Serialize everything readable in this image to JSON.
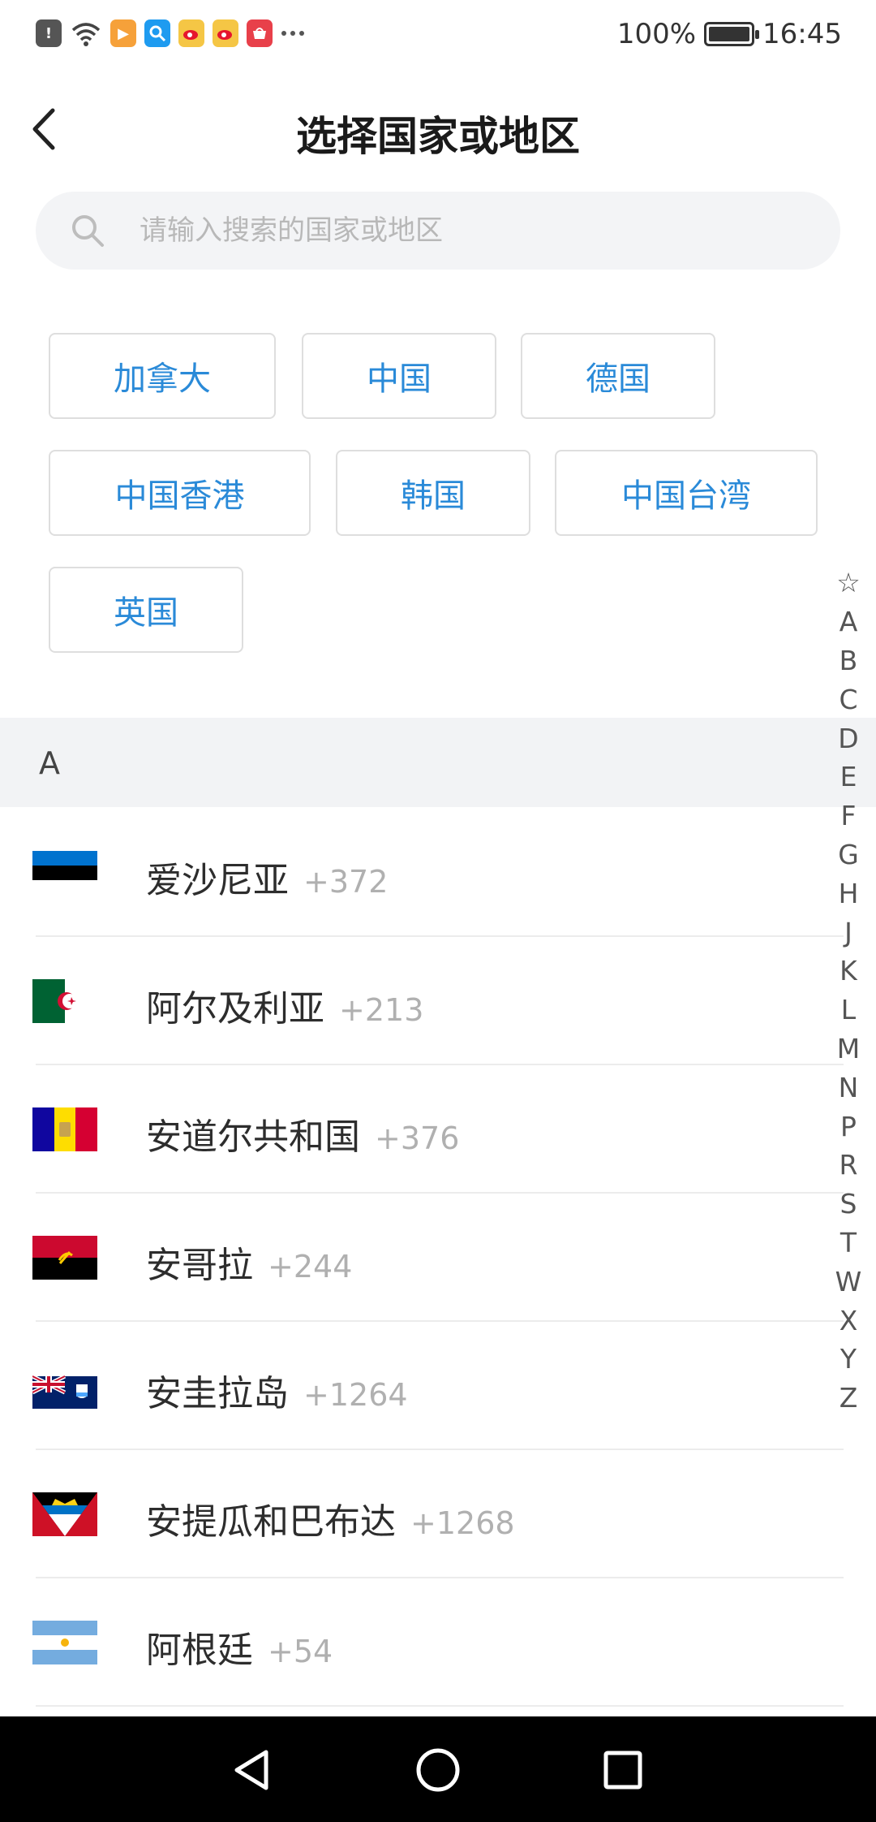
{
  "status_bar": {
    "battery_text": "100%",
    "time": "16:45",
    "battery_level": 1.0,
    "notification_icons": [
      "alert-icon",
      "wifi-icon",
      "video-app-icon",
      "search-app-icon",
      "weibo-icon",
      "weibo-icon",
      "huawei-icon",
      "more-icon"
    ]
  },
  "header": {
    "title": "选择国家或地区"
  },
  "search": {
    "placeholder": "请输入搜索的国家或地区"
  },
  "hot_regions": [
    "加拿大",
    "中国",
    "德国",
    "中国香港",
    "韩国",
    "中国台湾",
    "英国"
  ],
  "section": {
    "letter": "A"
  },
  "countries": [
    {
      "name": "爱沙尼亚",
      "code": "+372"
    },
    {
      "name": "阿尔及利亚",
      "code": "+213"
    },
    {
      "name": "安道尔共和国",
      "code": "+376"
    },
    {
      "name": "安哥拉",
      "code": "+244"
    },
    {
      "name": "安圭拉岛",
      "code": "+1264"
    },
    {
      "name": "安提瓜和巴布达",
      "code": "+1268"
    },
    {
      "name": "阿根廷",
      "code": "+54"
    }
  ],
  "index_bar": [
    "☆",
    "A",
    "B",
    "C",
    "D",
    "E",
    "F",
    "G",
    "H",
    "J",
    "K",
    "L",
    "M",
    "N",
    "P",
    "R",
    "S",
    "T",
    "W",
    "X",
    "Y",
    "Z"
  ],
  "colors": {
    "accent": "#2a8ad8",
    "chip_border": "#dedede",
    "section_bg": "#f2f3f5",
    "nav_bar": "#000000"
  }
}
